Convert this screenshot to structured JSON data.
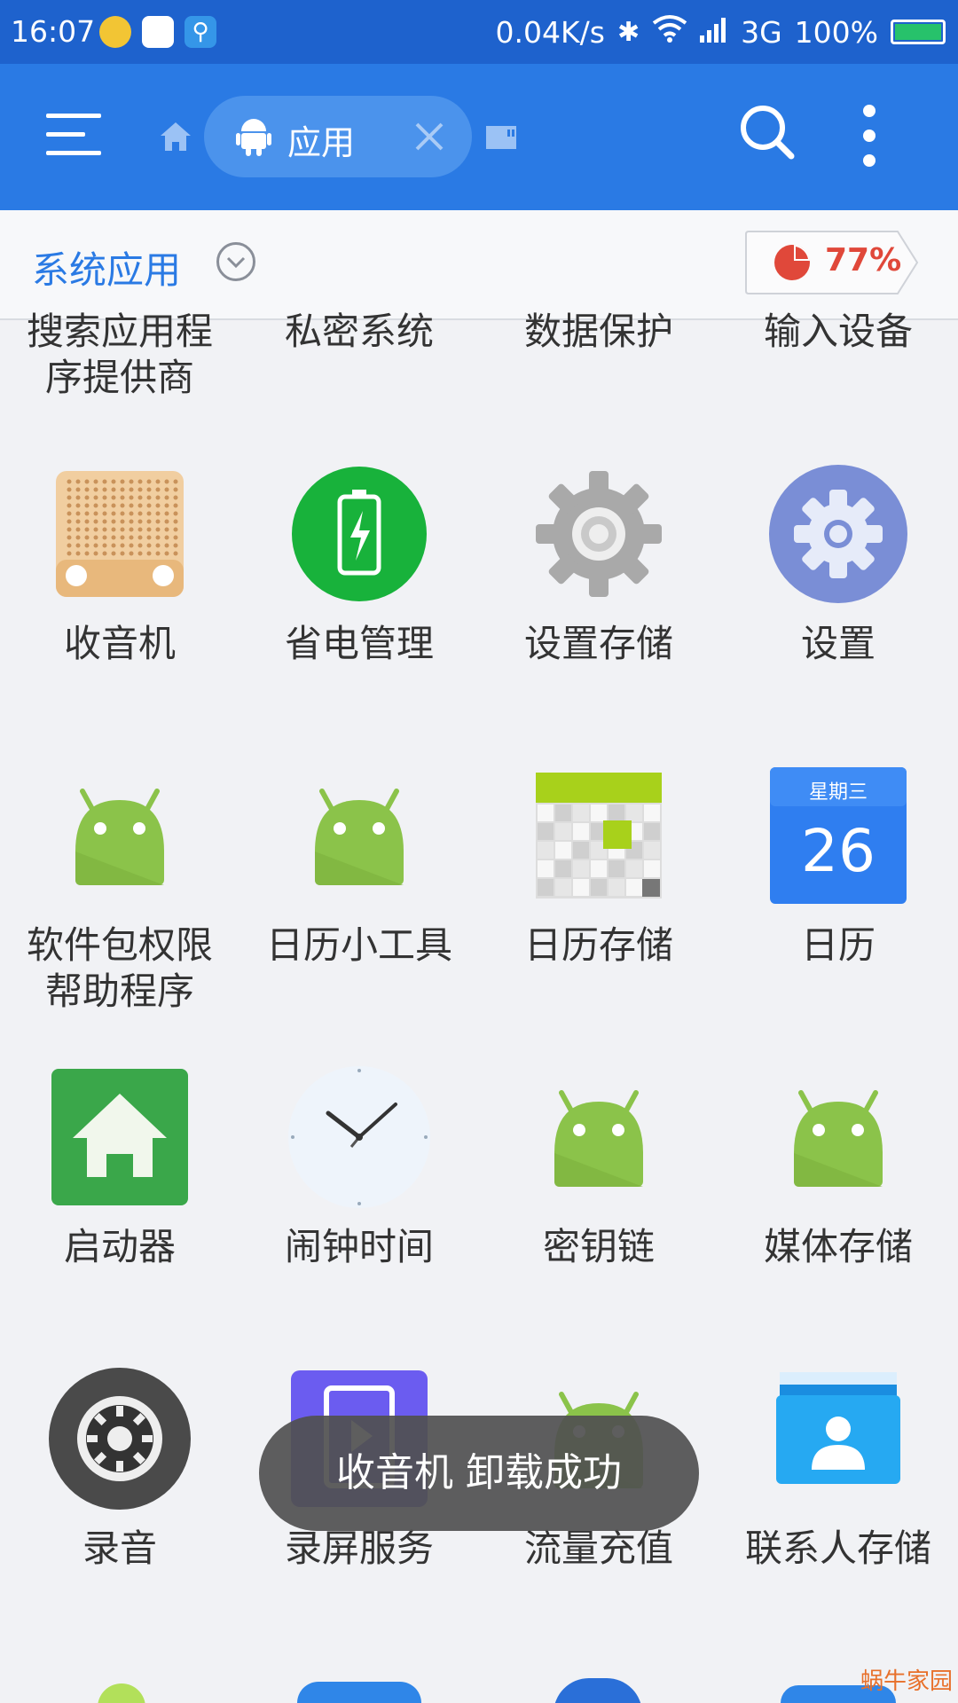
{
  "status_bar": {
    "time": "16:07",
    "speed": "0.04K/s",
    "network": "3G",
    "battery": "100%",
    "battery_level": 1.0
  },
  "toolbar": {
    "tab_label": "应用"
  },
  "filter": {
    "label": "系统应用",
    "storage_percent": "77%"
  },
  "apps": [
    {
      "name": "搜索应用程\n序提供商",
      "icon": "android-icon"
    },
    {
      "name": "私密系统",
      "icon": "none"
    },
    {
      "name": "数据保护",
      "icon": "none"
    },
    {
      "name": "输入设备",
      "icon": "none"
    },
    {
      "name": "收音机",
      "icon": "radio-icon"
    },
    {
      "name": "省电管理",
      "icon": "battery-saver-icon"
    },
    {
      "name": "设置存储",
      "icon": "gear-icon"
    },
    {
      "name": "设置",
      "icon": "settings-icon"
    },
    {
      "name": "软件包权限\n帮助程序",
      "icon": "android-icon"
    },
    {
      "name": "日历小工具",
      "icon": "android-icon"
    },
    {
      "name": "日历存储",
      "icon": "calendar-storage-icon"
    },
    {
      "name": "日历",
      "icon": "calendar-icon"
    },
    {
      "name": "启动器",
      "icon": "launcher-icon"
    },
    {
      "name": "闹钟时间",
      "icon": "clock-icon"
    },
    {
      "name": "密钥链",
      "icon": "android-icon"
    },
    {
      "name": "媒体存储",
      "icon": "android-icon"
    },
    {
      "name": "录音",
      "icon": "recorder-icon"
    },
    {
      "name": "录屏服务",
      "icon": "screen-record-icon"
    },
    {
      "name": "流量充值",
      "icon": "android-icon"
    },
    {
      "name": "联系人存储",
      "icon": "contacts-icon"
    }
  ],
  "calendar_icon": {
    "weekday": "星期三",
    "day": "26"
  },
  "toast": "收音机 卸载成功",
  "watermark": "蜗牛家园",
  "colors": {
    "status_bar": "#1e62cd",
    "app_bar": "#2a7ae4",
    "accent": "#2a7ae4",
    "usage": "#e0483a",
    "android_green": "#8bc34a"
  }
}
